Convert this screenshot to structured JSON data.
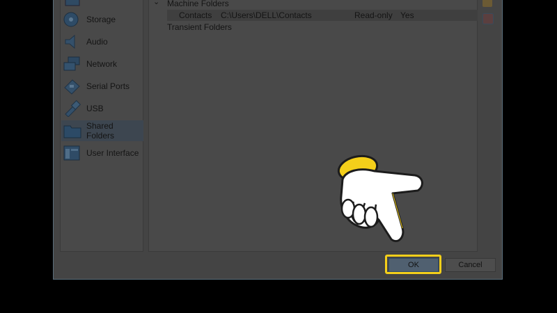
{
  "sidebar": {
    "items": [
      {
        "label": "Storage",
        "icon": "storage-icon"
      },
      {
        "label": "Audio",
        "icon": "audio-icon"
      },
      {
        "label": "Network",
        "icon": "network-icon"
      },
      {
        "label": "Serial Ports",
        "icon": "serial-ports-icon"
      },
      {
        "label": "USB",
        "icon": "usb-icon"
      },
      {
        "label": "Shared Folders",
        "icon": "shared-folders-icon",
        "selected": true
      },
      {
        "label": "User Interface",
        "icon": "user-interface-icon"
      }
    ]
  },
  "folders": {
    "machine_group": "Machine Folders",
    "transient_group": "Transient Folders",
    "row": {
      "name": "Contacts",
      "path": "C:\\Users\\DELL\\Contacts",
      "access": "Read-only",
      "auto_mount": "Yes"
    }
  },
  "buttons": {
    "ok": "OK",
    "cancel": "Cancel"
  },
  "colors": {
    "highlight": "#f4cf1a",
    "hand_fill": "#ffffff",
    "hand_outline": "#f4cf1a"
  }
}
